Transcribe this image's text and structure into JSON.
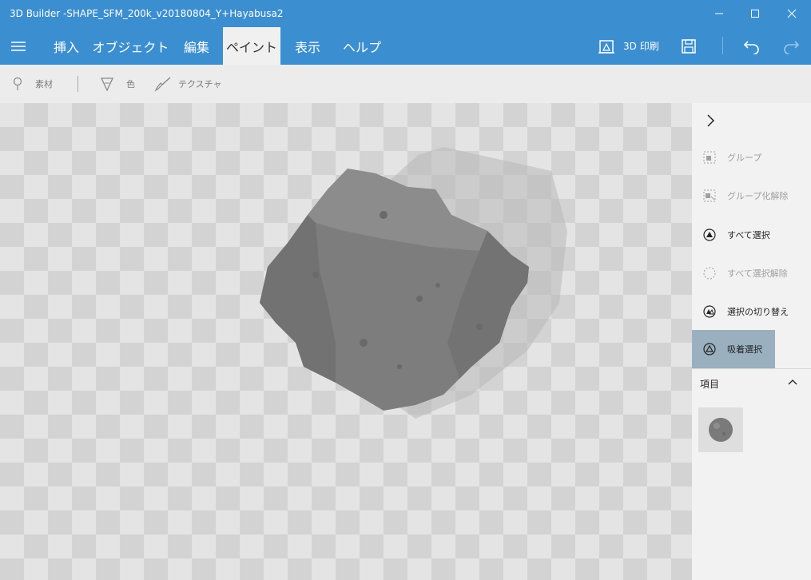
{
  "window": {
    "title": "3D Builder -SHAPE_SFM_200k_v20180804_Y+Hayabusa2"
  },
  "colors": {
    "accent": "#3b8ed0",
    "active_item": "#9ab0bf",
    "model": "#7a7a7a"
  },
  "menu": {
    "tabs": [
      {
        "label": "挿入"
      },
      {
        "label": "オブジェクト"
      },
      {
        "label": "編集"
      },
      {
        "label": "ペイント"
      },
      {
        "label": "表示"
      },
      {
        "label": "ヘルプ"
      }
    ],
    "active_tab": "ペイント",
    "print_label": "3D 印刷"
  },
  "toolbar": {
    "material_label": "素材",
    "color_label": "色",
    "texture_label": "テクスチャ"
  },
  "side": {
    "group_label": "グループ",
    "ungroup_label": "グループ化解除",
    "select_all_label": "すべて選択",
    "deselect_all_label": "すべて選択解除",
    "toggle_selection_label": "選択の切り替え",
    "magnetic_select_label": "吸着選択",
    "items_heading": "項目"
  },
  "icons": [
    "hamburger-icon",
    "printer-icon",
    "save-icon",
    "undo-icon",
    "redo-icon",
    "minimize-icon",
    "maximize-icon",
    "close-icon",
    "material-icon",
    "color-icon",
    "texture-brush-icon",
    "chevron-right-icon",
    "group-icon",
    "ungroup-icon",
    "select-all-icon",
    "deselect-all-icon",
    "toggle-selection-icon",
    "magnetic-select-icon",
    "chevron-up-icon"
  ]
}
